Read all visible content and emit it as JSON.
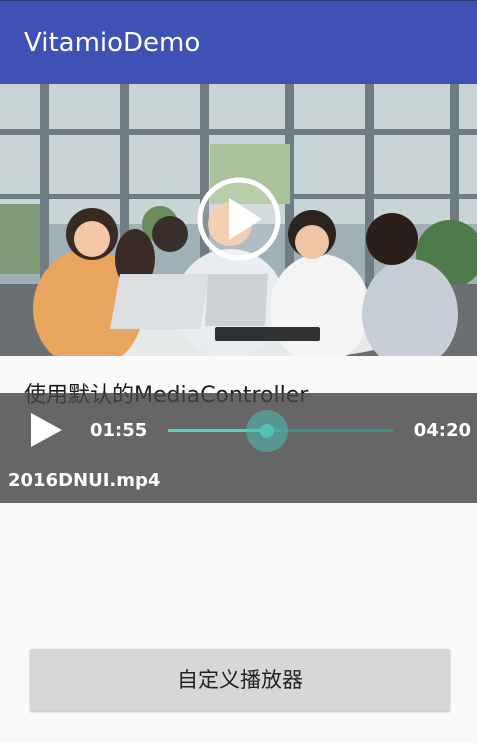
{
  "app": {
    "title": "VitamioDemo",
    "accent_color": "#3f51b5"
  },
  "video": {
    "overlay_icon": "play-icon"
  },
  "caption": "使用默认的MediaController",
  "controller": {
    "play_icon": "play-icon",
    "current_time": "01:55",
    "total_time": "04:20",
    "progress": 0.44,
    "file_name": "2016DNUI.mp4",
    "accent_color": "#4fc3b9"
  },
  "custom_button": {
    "label": "自定义播放器"
  }
}
